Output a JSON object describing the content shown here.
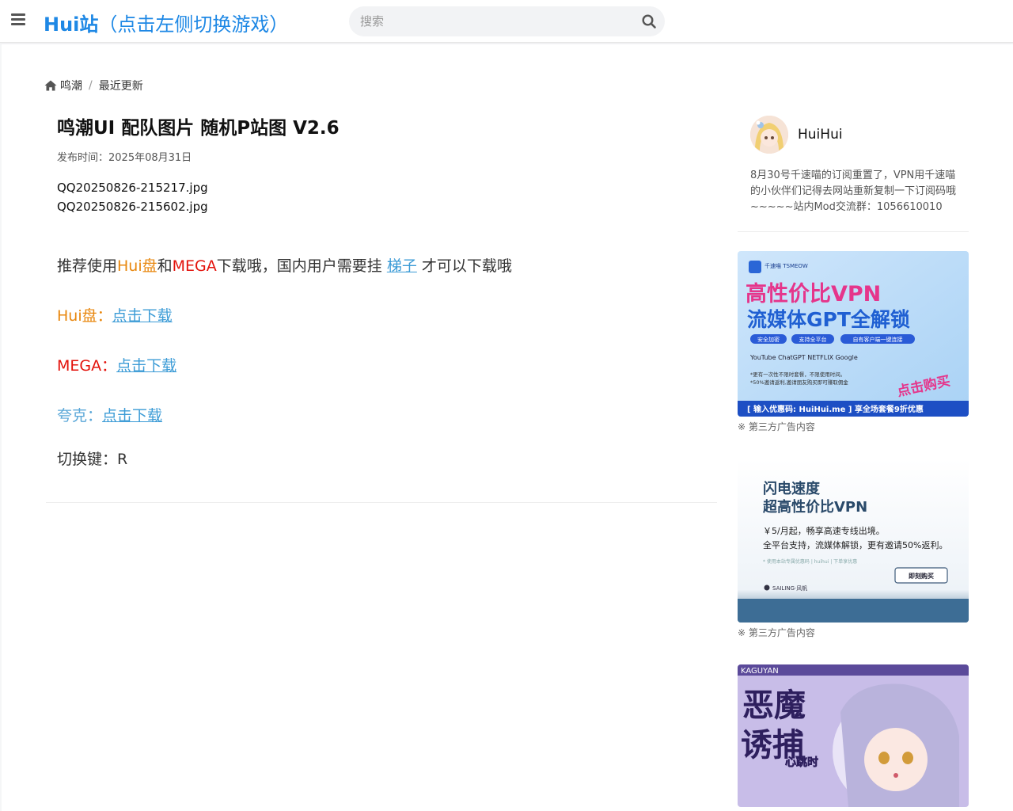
{
  "header": {
    "site_name": "Hui站",
    "site_suffix": "（点击左侧切换游戏）",
    "search_placeholder": "搜索",
    "accent_color": "#1e88e5"
  },
  "breadcrumb": {
    "items": [
      "鸣潮",
      "最近更新"
    ],
    "separator": "/"
  },
  "article": {
    "title": "鸣潮UI 配队图片 随机P站图 V2.6",
    "date": "发布时间：2025年08月31日",
    "files": [
      "QQ20250826-215217.jpg",
      "QQ20250826-215602.jpg"
    ],
    "recommend": {
      "prefix": "推荐使用",
      "hui": "Hui盘",
      "and": "和",
      "mega": "MEGA",
      "mid": "下载哦，国内用户需要挂",
      "ladder": "梯子",
      "suffix": "才可以下载哦"
    },
    "downloads": [
      {
        "label": "Hui盘：",
        "link": "点击下载",
        "color": "#e8870e"
      },
      {
        "label": "MEGA：",
        "link": "点击下载",
        "color": "#e3120b"
      },
      {
        "label": "夸克：",
        "link": "点击下载",
        "color": "#5aa7d8"
      }
    ],
    "hotkey": "切换键：R"
  },
  "sidebar": {
    "author_name": "HuiHui",
    "notice": "8月30号千速喵的订阅重置了，VPN用千速喵的小伙伴们记得去网站重新复制一下订阅码哦~~~~~站内Mod交流群：1056610010",
    "ad_note": "※ 第三方广告内容",
    "ad1": {
      "brand": "千速喵 TSMEOW",
      "line1": "高性价比VPN",
      "line2": "流媒体GPT全解锁",
      "tags": [
        "安全加密",
        "支持全平台",
        "自有客户端一键连接"
      ],
      "apps": "YouTube ChatGPT NETFLIX Google",
      "fine1": "*更有一次性不限时套餐，不限使用时间。",
      "fine2": "*50%邀请返利,邀请朋友购买即可赚取佣金",
      "buy": "点击购买",
      "promo": "[ 输入优惠码: HuiHui.me ] 享全场套餐9折优惠"
    },
    "ad2": {
      "line1": "闪电速度",
      "line2": "超高性价比VPN",
      "desc1": "￥5/月起，畅享高速专线出境。",
      "desc2": "全平台支持，流媒体解锁，更有邀请50%返利。",
      "fine": "* 使用本站专属优惠码 | huihui | 下单享优惠",
      "button": "即刻购买",
      "brand": "SAILING·风帆"
    },
    "ad3": {
      "brand": "KAGUYAN",
      "title1": "恶魔",
      "title2": "诱捕",
      "sub": "心跳时"
    }
  }
}
